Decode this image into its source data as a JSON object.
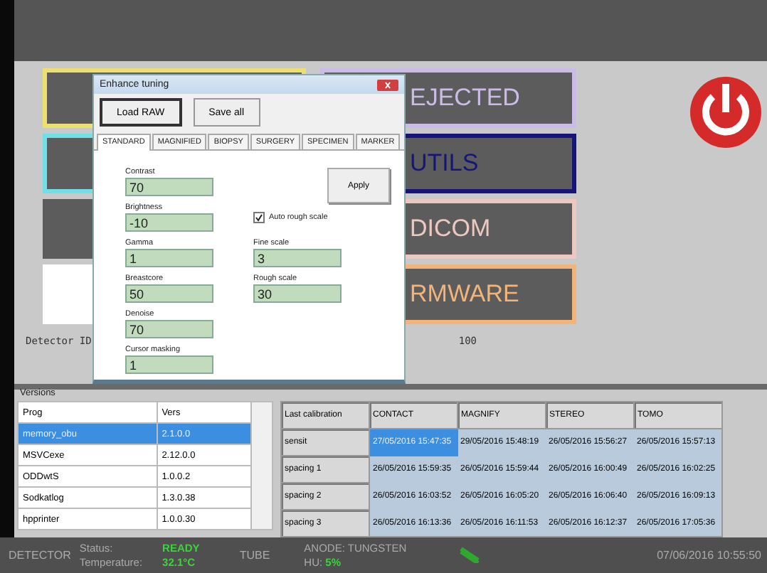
{
  "left_tiles": [
    {
      "color": "#eee070"
    },
    {
      "color": "#70e0e8"
    },
    {
      "color": "#5c5c5c"
    },
    {
      "color": "#ffffff"
    }
  ],
  "right_tiles": [
    {
      "label": "EJECTED",
      "color": "#cbbbe8"
    },
    {
      "label": "UTILS",
      "color": "#16167a"
    },
    {
      "label": "DICOM",
      "color": "#ecc8c0"
    },
    {
      "label": "RMWARE",
      "color": "#f2b478"
    }
  ],
  "detector": {
    "label": "Detector ID",
    "value": "100"
  },
  "dialog": {
    "title": "Enhance tuning",
    "buttons": [
      "Load RAW",
      "Save all"
    ],
    "tabs": [
      {
        "label": "STANDARD",
        "selected": true
      },
      {
        "label": "MAGNIFIED",
        "selected": false
      },
      {
        "label": "BIOPSY",
        "selected": false
      },
      {
        "label": "SURGERY",
        "selected": false
      },
      {
        "label": "SPECIMEN",
        "selected": false
      },
      {
        "label": "MARKER",
        "selected": false
      }
    ],
    "fields": [
      {
        "label": "Contrast",
        "value": "70"
      },
      {
        "label": "Brightness",
        "value": "-10"
      },
      {
        "label": "Gamma",
        "value": "1"
      },
      {
        "label": "Breastcore",
        "value": "50"
      },
      {
        "label": "Denoise",
        "value": "70"
      },
      {
        "label": "Cursor masking",
        "value": "1"
      }
    ],
    "right_items": [
      {
        "kind": "button",
        "label": "Apply"
      },
      {
        "kind": "checkbox",
        "label": "Auto rough scale",
        "checked": true
      },
      {
        "kind": "field",
        "label": "Fine scale",
        "value": "3"
      },
      {
        "kind": "field",
        "label": "Rough scale",
        "value": "30"
      }
    ]
  },
  "versions": {
    "title": "Versions",
    "columns": [
      "Prog",
      "Vers"
    ],
    "rows": [
      {
        "cells": [
          "memory_obu",
          "2.1.0.0"
        ],
        "selected": true
      },
      {
        "cells": [
          "MSVCexe",
          "2.12.0.0"
        ],
        "selected": false
      },
      {
        "cells": [
          "ODDwtS",
          "1.0.0.2"
        ],
        "selected": false
      },
      {
        "cells": [
          "Sodkatlog",
          "1.3.0.38"
        ],
        "selected": false
      },
      {
        "cells": [
          "hpprinter",
          "1.0.0.30"
        ],
        "selected": false
      }
    ]
  },
  "calibration": {
    "columns": [
      "Last calibration",
      "CONTACT",
      "MAGNIFY",
      "STEREO",
      "TOMO"
    ],
    "rows": [
      {
        "cells": [
          {
            "text": "sensit",
            "selected": false
          },
          {
            "text": "27/05/2016 15:47:35",
            "selected": true
          },
          {
            "text": "29/05/2016 15:48:19",
            "selected": false
          },
          {
            "text": "26/05/2016 15:56:27",
            "selected": false
          },
          {
            "text": "26/05/2016 15:57:13",
            "selected": false
          }
        ]
      },
      {
        "cells": [
          {
            "text": "spacing 1",
            "selected": false
          },
          {
            "text": "26/05/2016 15:59:35",
            "selected": false
          },
          {
            "text": "26/05/2016 15:59:44",
            "selected": false
          },
          {
            "text": "26/05/2016 16:00:49",
            "selected": false
          },
          {
            "text": "26/05/2016 16:02:25",
            "selected": false
          }
        ]
      },
      {
        "cells": [
          {
            "text": "spacing 2",
            "selected": false
          },
          {
            "text": "26/05/2016 16:03:52",
            "selected": false
          },
          {
            "text": "26/05/2016 16:05:20",
            "selected": false
          },
          {
            "text": "26/05/2016 16:06:40",
            "selected": false
          },
          {
            "text": "26/05/2016 16:09:13",
            "selected": false
          }
        ]
      },
      {
        "cells": [
          {
            "text": "spacing 3",
            "selected": false
          },
          {
            "text": "26/05/2016 16:13:36",
            "selected": false
          },
          {
            "text": "26/05/2016 16:11:53",
            "selected": false
          },
          {
            "text": "26/05/2016 16:12:37",
            "selected": false
          },
          {
            "text": "26/05/2016 17:05:36",
            "selected": false
          }
        ]
      }
    ]
  },
  "status_bar": {
    "detector": "DETECTOR",
    "status_label": "Status:",
    "status": "READY",
    "temperature_label": "Temperature:",
    "temperature": "32.1°C",
    "tube": "TUBE",
    "anode": "ANODE: TUNGSTEN",
    "hu_label": "HU:",
    "hu": "5%",
    "datetime": "07/06/2016 10:55:50"
  }
}
